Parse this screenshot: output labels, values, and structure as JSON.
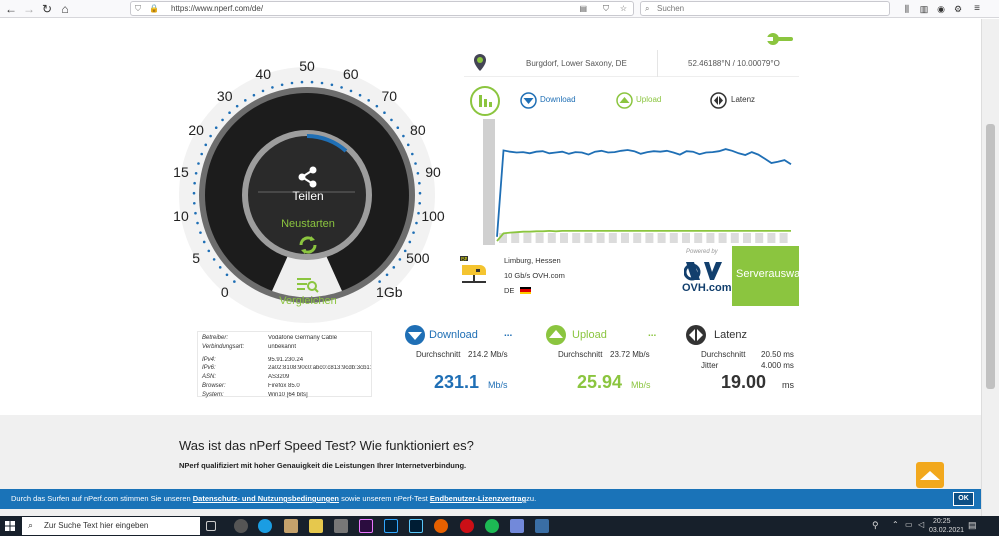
{
  "browser": {
    "url": "https://www.nperf.com/de/",
    "search_placeholder": "Suchen"
  },
  "location": {
    "place": "Burgdorf, Lower Saxony, DE",
    "coords": "52.46188°N / 10.00079°O"
  },
  "gauge": {
    "ticks": [
      "0",
      "5",
      "10",
      "15",
      "20",
      "30",
      "40",
      "50",
      "60",
      "70",
      "80",
      "90",
      "100",
      "500",
      "1Gb"
    ],
    "share_label": "Teilen",
    "restart_label": "Neustarten",
    "compare_label": "Vergleichen"
  },
  "legend": {
    "download": "Download",
    "upload": "Upload",
    "latency": "Latenz"
  },
  "server": {
    "city": "Limburg, Hessen",
    "provider": "10 Gb/s OVH.com",
    "country": "DE",
    "powered_by": "Powered by",
    "sponsor_logo": "OVH.com",
    "button": "Serverauswa"
  },
  "info": {
    "rows": [
      {
        "k": "Betreiber:",
        "v": "Vodafone Germany Cable"
      },
      {
        "k": "Verbindungsart:",
        "v": "unbekannt"
      },
      {
        "k": "IPv4:",
        "v": "95.91.230.24"
      },
      {
        "k": "IPv6:",
        "v": "2a02:8108:90c0:abc0:c813:9cdb:3cb1:"
      },
      {
        "k": "ASN:",
        "v": "AS3209"
      },
      {
        "k": "Browser:",
        "v": "Firefox 85.0"
      },
      {
        "k": "System:",
        "v": "Win10 [64 bits]"
      }
    ]
  },
  "results": {
    "download": {
      "title": "Download",
      "avg_label": "Durchschnitt",
      "avg": "214.2 Mb/s",
      "value": "231.1",
      "unit": "Mb/s",
      "more": "..."
    },
    "upload": {
      "title": "Upload",
      "avg_label": "Durchschnitt",
      "avg": "23.72 Mb/s",
      "value": "25.94",
      "unit": "Mb/s",
      "more": "..."
    },
    "latency": {
      "title": "Latenz",
      "avg_label": "Durchschnitt",
      "avg": "20.50 ms",
      "jitter_label": "Jitter",
      "jitter": "4.000 ms",
      "value": "19.00",
      "unit": "ms"
    }
  },
  "article": {
    "heading": "Was ist das nPerf Speed Test? Wie funktioniert es?",
    "subtext": "NPerf qualifiziert mit hoher Genauigkeit die Leistungen Ihrer Internetverbindung."
  },
  "cookie": {
    "text_before": "Durch das Surfen auf nPerf.com stimmen Sie unseren",
    "link1": "Datenschutz- und Nutzungsbedingungen",
    "text_mid": "sowie unserem nPerf-Test",
    "link2": "Endbenutzer-Lizenzvertrag",
    "text_after": "zu.",
    "ok": "OK"
  },
  "taskbar": {
    "search_placeholder": "Zur Suche Text hier eingeben",
    "time": "20:25",
    "date": "03.02.2021"
  },
  "colors": {
    "download": "#1f6fb5",
    "upload": "#8bc53f",
    "ovh_blue": "#123f6d"
  },
  "chart_data": {
    "type": "line",
    "series": [
      {
        "name": "Download",
        "values": [
          10,
          215,
          212,
          210,
          211,
          208,
          212,
          213,
          208,
          210,
          212,
          207,
          211,
          210,
          205,
          212,
          214,
          210,
          211,
          214,
          216,
          213,
          207,
          211,
          213,
          212,
          214,
          210,
          205,
          213,
          212,
          206,
          210,
          211,
          213,
          218,
          214,
          208,
          204,
          211,
          205,
          195,
          185,
          188,
          192,
          182
        ]
      },
      {
        "name": "Upload",
        "values": [
          0,
          18,
          20,
          21,
          22,
          22,
          23,
          23,
          24,
          23,
          24,
          24,
          24,
          24,
          24,
          24,
          24,
          24,
          24,
          24,
          24,
          24,
          24,
          24,
          24,
          24,
          24,
          24,
          24,
          24,
          24,
          24,
          24,
          24,
          24,
          24,
          24,
          24,
          24,
          24,
          24,
          24,
          24,
          24,
          24,
          24
        ]
      }
    ],
    "ylim": [
      0,
      280
    ],
    "grid": false
  }
}
